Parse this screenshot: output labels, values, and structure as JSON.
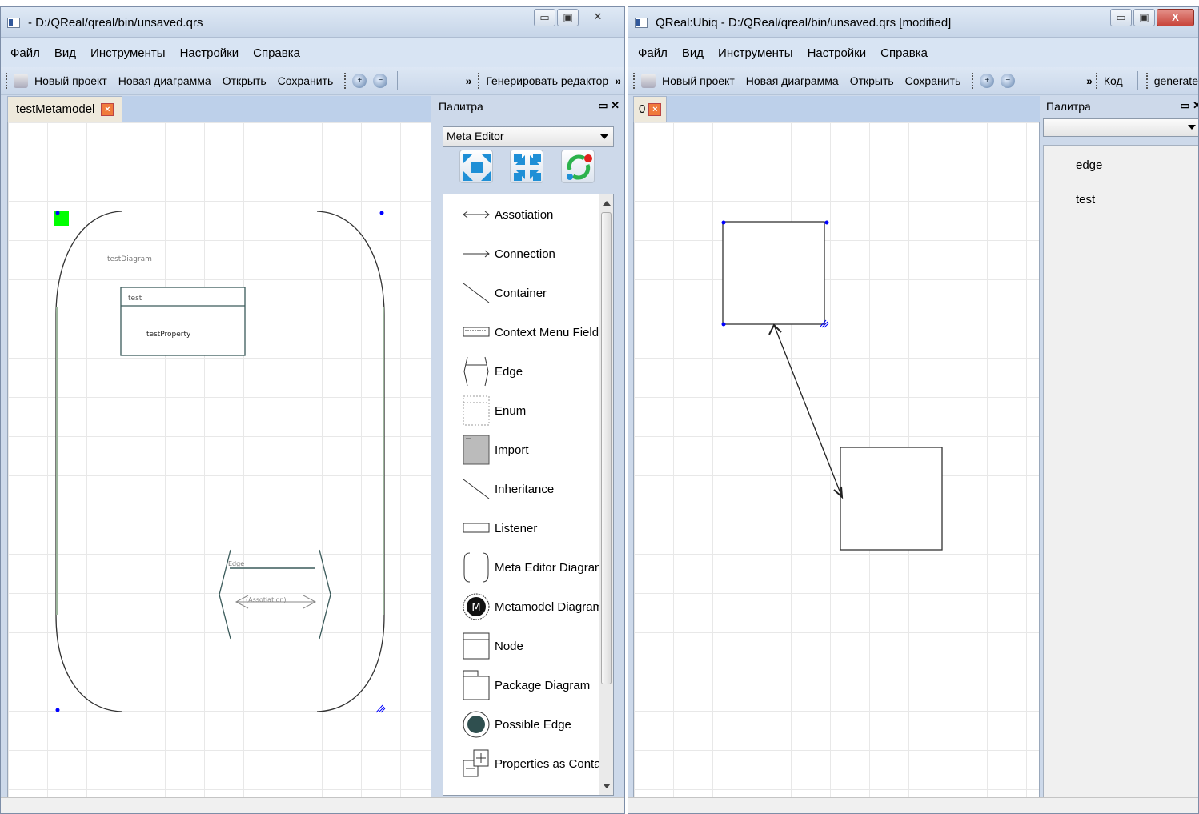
{
  "left": {
    "title": "- D:/QReal/qreal/bin/unsaved.qrs",
    "menu": [
      "Файл",
      "Вид",
      "Инструменты",
      "Настройки",
      "Справка"
    ],
    "toolbar": {
      "new_project": "Новый проект",
      "new_diagram": "Новая диаграмма",
      "open": "Открыть",
      "save": "Сохранить",
      "more": "»",
      "generate": "Генерировать редактор",
      "more2": "»"
    },
    "tab": "testMetamodel",
    "palette": {
      "title": "Палитра",
      "editor": "Meta Editor",
      "items": [
        "Assotiation",
        "Connection",
        "Container",
        "Context Menu Field",
        "Edge",
        "Enum",
        "Import",
        "Inheritance",
        "Listener",
        "Meta Editor Diagram",
        "Metamodel Diagram",
        "Node",
        "Package Diagram",
        "Possible Edge",
        "Properties as Contair"
      ]
    },
    "diagram": {
      "name": "testDiagram",
      "node_name": "test",
      "node_property": "testProperty",
      "edge_name": "Edge",
      "edge_assoc": "(Assotiation)"
    }
  },
  "right": {
    "title": "QReal:Ubiq - D:/QReal/qreal/bin/unsaved.qrs [modified]",
    "menu": [
      "Файл",
      "Вид",
      "Инструменты",
      "Настройки",
      "Справка"
    ],
    "toolbar": {
      "new_project": "Новый проект",
      "new_diagram": "Новая диаграмма",
      "open": "Открыть",
      "save": "Сохранить",
      "more": "»",
      "code": "Код",
      "generate": "generate"
    },
    "tab": "0",
    "palette": {
      "title": "Палитра",
      "editor": "",
      "items": [
        "edge",
        "test"
      ]
    }
  },
  "icons": {
    "minimize": "minimize-icon",
    "maximize": "maximize-icon",
    "close": "close-icon",
    "zoom_in": "zoom-in-icon",
    "zoom_out": "zoom-out-icon",
    "printer": "printer-icon"
  },
  "colors": {
    "accent": "#cdd9ea",
    "tab_close": "#f07b3c",
    "selection": "#0000ff",
    "resize_handle": "#00ff00"
  }
}
